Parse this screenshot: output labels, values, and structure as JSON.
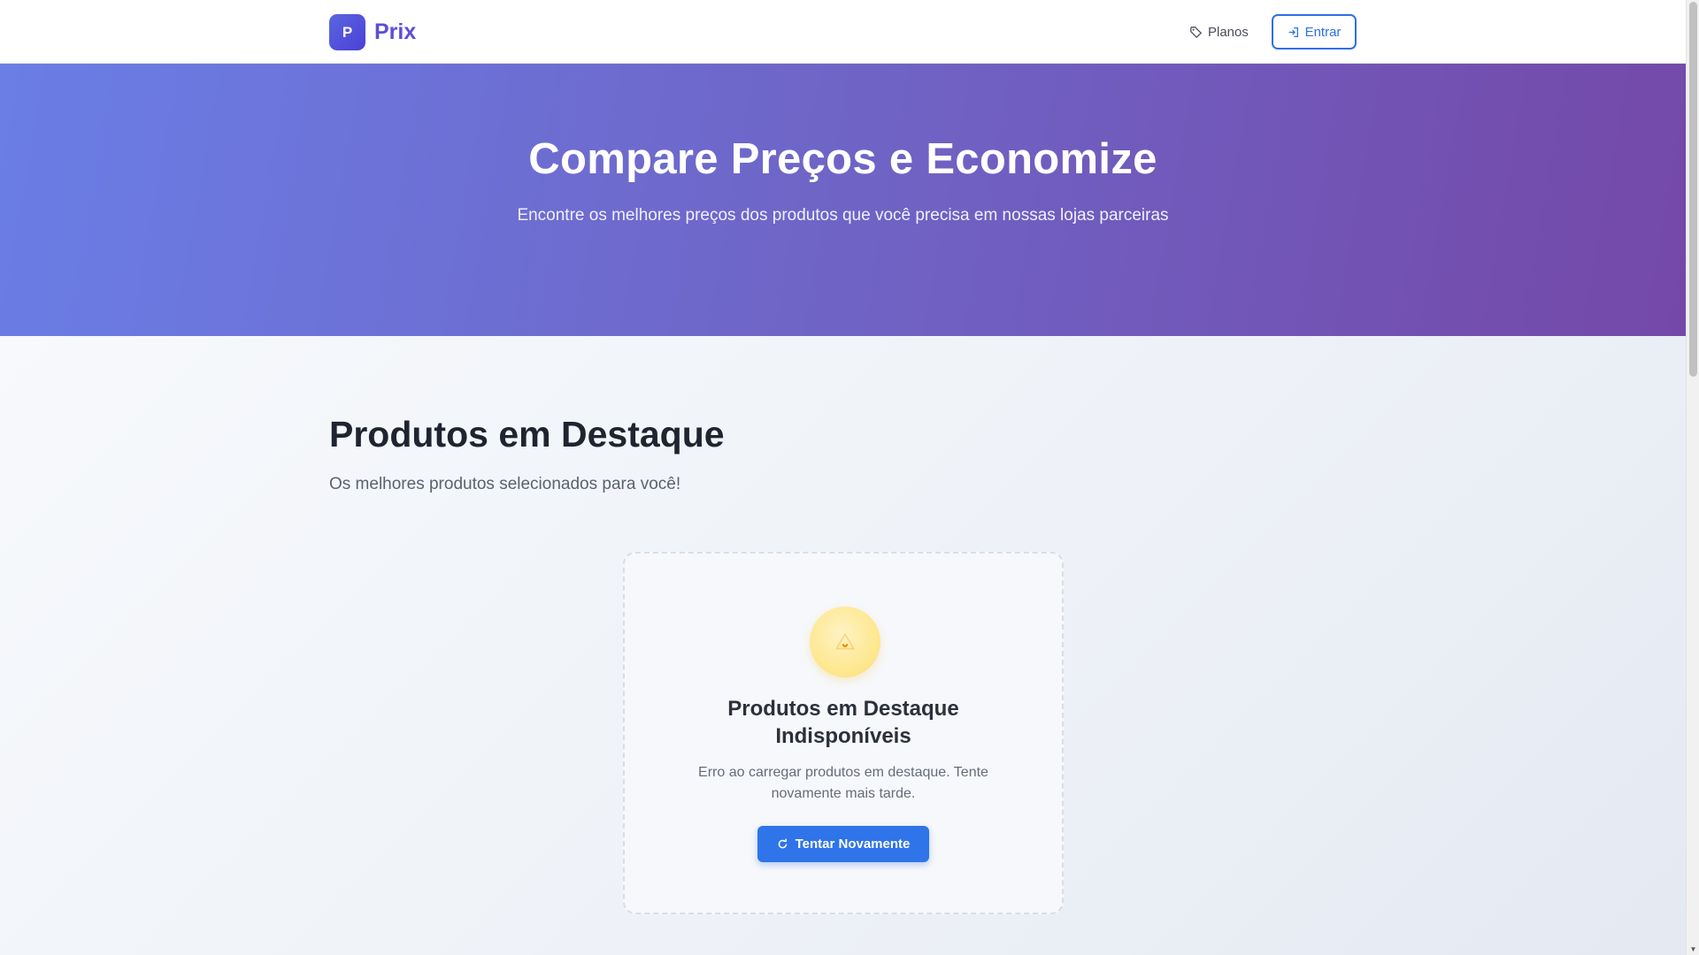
{
  "navbar": {
    "logo_letter": "P",
    "brand_name": "Prix",
    "plans_label": "Planos",
    "login_label": "Entrar"
  },
  "hero": {
    "title": "Compare Preços e Economize",
    "subtitle": "Encontre os melhores preços dos produtos que você precisa em nossas lojas parceiras"
  },
  "featured": {
    "title": "Produtos em Destaque",
    "subtitle": "Os melhores produtos selecionados para você!",
    "error": {
      "icon": "warning-icon",
      "title": "Produtos em Destaque Indisponíveis",
      "message": "Erro ao carregar produtos em destaque. Tente novamente mais tarde.",
      "retry_label": "Tentar Novamente"
    }
  },
  "colors": {
    "brand": "#5a4fd6",
    "primary": "#2f74e8",
    "hero_gradient_start": "#6a7ee6",
    "hero_gradient_end": "#7448a8",
    "warning": "#f59e0b"
  }
}
